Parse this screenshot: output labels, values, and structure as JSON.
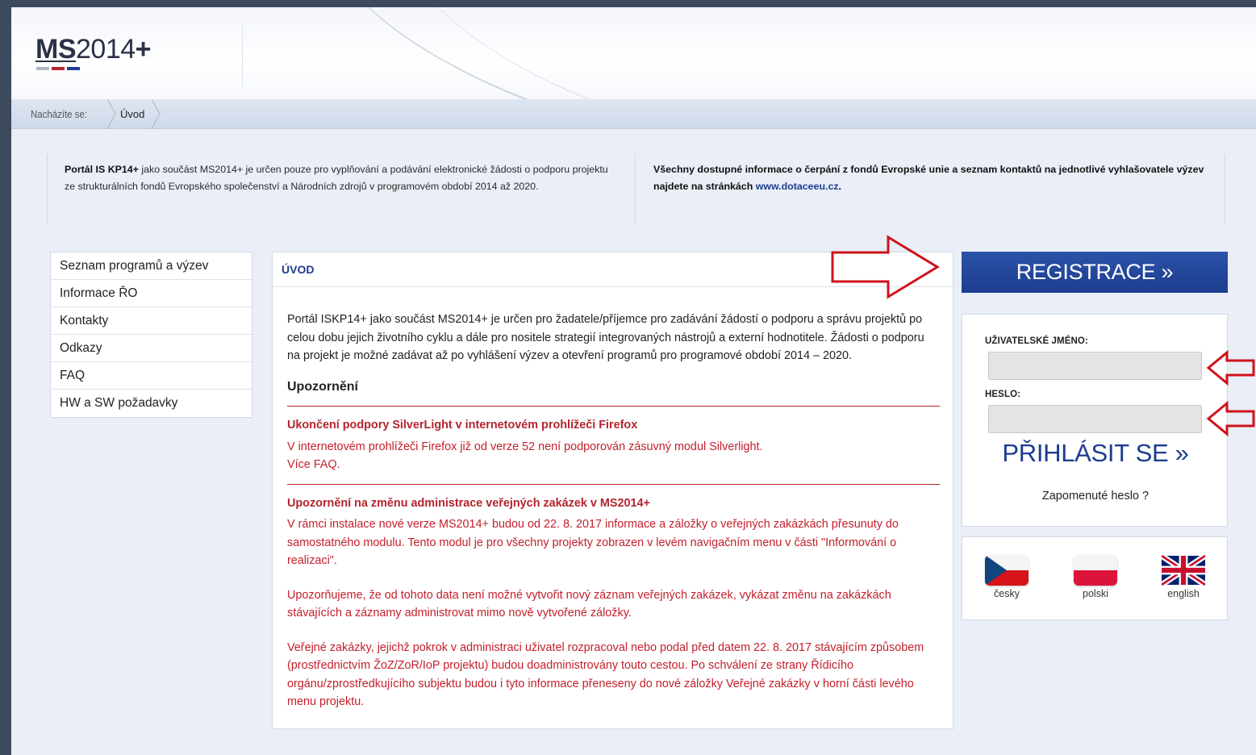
{
  "header": {
    "logo_main": "MS",
    "logo_year": "2014",
    "logo_plus": "+",
    "logo_bar_colors": [
      "#b0b7c3",
      "#b3252e",
      "#1d3c8f"
    ]
  },
  "breadcrumb": {
    "label": "Nacházíte se:",
    "current": "Úvod"
  },
  "info": {
    "left_bold": "Portál IS KP14+",
    "left_text": " jako součást MS2014+ je určen pouze pro vyplňování a podávání elektronické žádosti o podporu projektu ze strukturálních fondů Evropského společenství a Národních zdrojů v programovém období 2014 až 2020.",
    "right_bold": "Všechny dostupné informace o čerpání z fondů Evropské unie a seznam kontaktů na jednotlivé vyhlašovatele výzev najdete na stránkách",
    "right_link": "www.dotaceeu.cz",
    "right_end": "."
  },
  "leftnav": {
    "items": [
      {
        "label": "Seznam programů a výzev"
      },
      {
        "label": "Informace ŘO"
      },
      {
        "label": "Kontakty"
      },
      {
        "label": "Odkazy"
      },
      {
        "label": "FAQ"
      },
      {
        "label": "HW a SW požadavky"
      }
    ]
  },
  "content": {
    "title": "ÚVOD",
    "intro": "Portál ISKP14+ jako součást MS2014+ je určen pro žadatele/příjemce pro zadávání žádostí o podporu a správu projektů po celou dobu jejich životního cyklu a dále pro nositele strategií integrovaných nástrojů a externí hodnotitele. Žádosti o podporu na projekt je možné zadávat až po vyhlášení výzev a otevření programů pro programové období 2014 – 2020.",
    "warning_heading": "Upozornění",
    "notices": [
      {
        "title": "Ukončení podpory SilverLight v internetovém prohlížeči Firefox",
        "lines": [
          "V internetovém prohlížeči Firefox již od verze 52 není podporován zásuvný modul Silverlight.",
          "Více FAQ."
        ]
      },
      {
        "title": "Upozornění na změnu administrace veřejných zakázek v MS2014+",
        "paragraphs": [
          "V rámci instalace nové verze MS2014+ budou od 22. 8. 2017 informace a záložky o veřejných zakázkách přesunuty do samostatného modulu. Tento modul je pro všechny projekty zobrazen v levém navigačním menu v části \"Informování o realizaci\".",
          "Upozorňujeme, že od tohoto data není možné vytvořit nový záznam veřejných zakázek, vykázat změnu na zakázkách stávajících a záznamy administrovat mimo nově vytvořené záložky.",
          "Veřejné zakázky, jejichž pokrok v administraci uživatel rozpracoval nebo podal před datem 22. 8. 2017 stávajícím způsobem (prostřednictvím ŽoZ/ZoR/IoP projektu) budou doadministrovány touto cestou. Po schválení ze strany Řídicího orgánu/zprostředkujícího subjektu budou i tyto informace přeneseny do nové záložky Veřejné zakázky v horní části levého menu projektu."
        ]
      }
    ]
  },
  "login": {
    "register_label": "REGISTRACE »",
    "username_label": "UŽIVATELSKÉ JMÉNO:",
    "username_value": "",
    "password_label": "HESLO:",
    "password_value": "",
    "login_label": "PŘIHLÁSIT SE »",
    "forgot_label": "Zapomenuté heslo ?"
  },
  "languages": [
    {
      "label": "česky",
      "icon": "czech-flag-icon"
    },
    {
      "label": "polski",
      "icon": "polish-flag-icon"
    },
    {
      "label": "english",
      "icon": "uk-flag-icon"
    }
  ],
  "colors": {
    "brand_blue": "#1d3c8f",
    "notice_red": "#c4202b",
    "annotation_red": "#d0121b"
  }
}
